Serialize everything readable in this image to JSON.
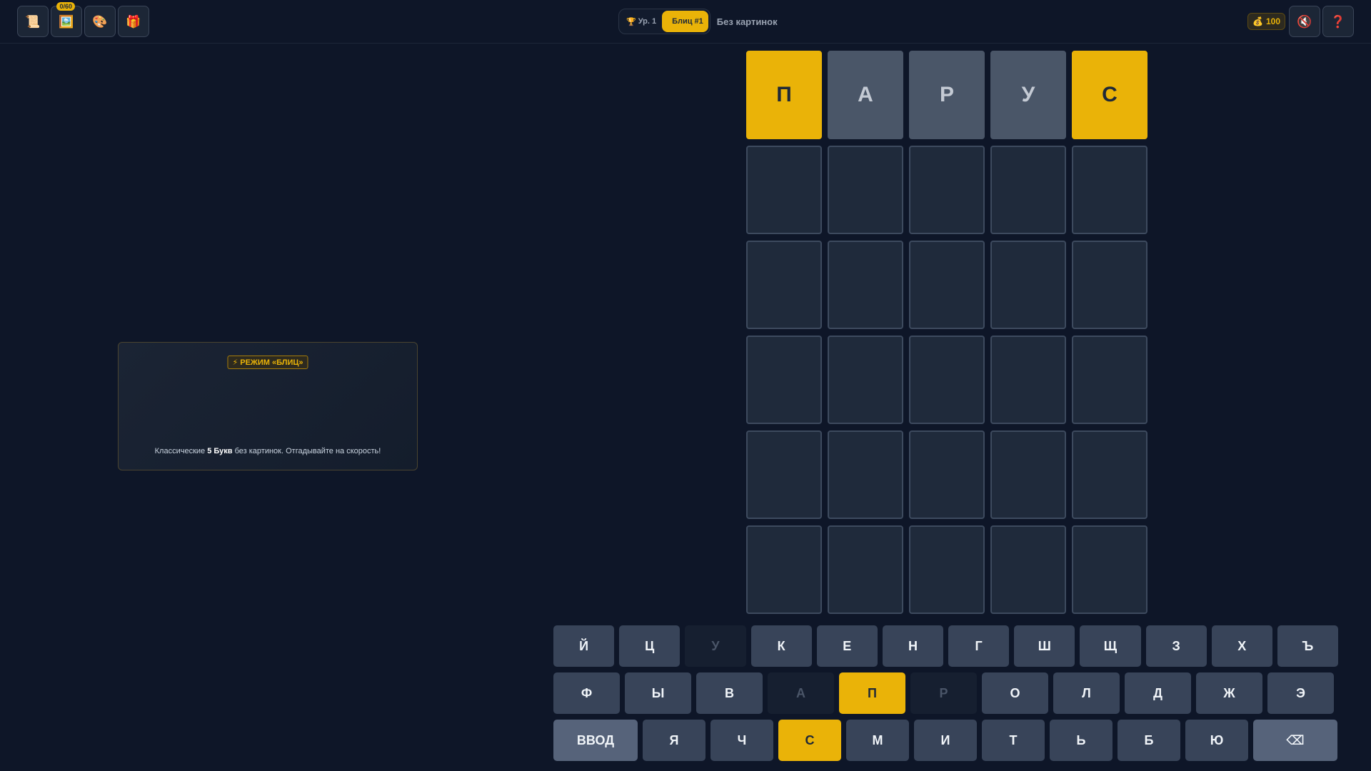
{
  "topbar": {
    "left_buttons": [
      {
        "icon": "📜",
        "icon_name": "scroll-icon"
      },
      {
        "icon": "🖼️",
        "icon_name": "picture-icon",
        "badge": "0/60"
      },
      {
        "icon": "🎨",
        "icon_name": "palette-icon"
      },
      {
        "icon": "🎁",
        "icon_name": "gift-icon"
      }
    ],
    "level_icon": "🏆",
    "level_label": "Ур. 1",
    "blitz_label": "Блиц #1",
    "subtitle": "Без картинок",
    "coins_icon": "💰",
    "coins": "100",
    "sound_icon": "🔇",
    "help_icon": "❓"
  },
  "info": {
    "tag": "⚡ РЕЖИМ «БЛИЦ»",
    "text_before": "Классические ",
    "text_bold": "5 Букв",
    "text_after": " без картинок. Отгадывайте на скорость!"
  },
  "board": {
    "rows": [
      [
        {
          "letter": "П",
          "state": "present"
        },
        {
          "letter": "А",
          "state": "absent"
        },
        {
          "letter": "Р",
          "state": "absent"
        },
        {
          "letter": "У",
          "state": "absent"
        },
        {
          "letter": "С",
          "state": "present"
        }
      ],
      [
        {
          "letter": "",
          "state": "empty"
        },
        {
          "letter": "",
          "state": "empty"
        },
        {
          "letter": "",
          "state": "empty"
        },
        {
          "letter": "",
          "state": "empty"
        },
        {
          "letter": "",
          "state": "empty"
        }
      ],
      [
        {
          "letter": "",
          "state": "empty"
        },
        {
          "letter": "",
          "state": "empty"
        },
        {
          "letter": "",
          "state": "empty"
        },
        {
          "letter": "",
          "state": "empty"
        },
        {
          "letter": "",
          "state": "empty"
        }
      ],
      [
        {
          "letter": "",
          "state": "empty"
        },
        {
          "letter": "",
          "state": "empty"
        },
        {
          "letter": "",
          "state": "empty"
        },
        {
          "letter": "",
          "state": "empty"
        },
        {
          "letter": "",
          "state": "empty"
        }
      ],
      [
        {
          "letter": "",
          "state": "empty"
        },
        {
          "letter": "",
          "state": "empty"
        },
        {
          "letter": "",
          "state": "empty"
        },
        {
          "letter": "",
          "state": "empty"
        },
        {
          "letter": "",
          "state": "empty"
        }
      ],
      [
        {
          "letter": "",
          "state": "empty"
        },
        {
          "letter": "",
          "state": "empty"
        },
        {
          "letter": "",
          "state": "empty"
        },
        {
          "letter": "",
          "state": "empty"
        },
        {
          "letter": "",
          "state": "empty"
        }
      ]
    ]
  },
  "keyboard": {
    "rows": [
      [
        {
          "label": "Й"
        },
        {
          "label": "Ц"
        },
        {
          "label": "У",
          "state": "absent"
        },
        {
          "label": "К"
        },
        {
          "label": "Е"
        },
        {
          "label": "Н"
        },
        {
          "label": "Г"
        },
        {
          "label": "Ш"
        },
        {
          "label": "Щ"
        },
        {
          "label": "З"
        },
        {
          "label": "Х"
        },
        {
          "label": "Ъ"
        }
      ],
      [
        {
          "label": "Ф"
        },
        {
          "label": "Ы"
        },
        {
          "label": "В"
        },
        {
          "label": "А",
          "state": "absent"
        },
        {
          "label": "П",
          "state": "present"
        },
        {
          "label": "Р",
          "state": "absent"
        },
        {
          "label": "О"
        },
        {
          "label": "Л"
        },
        {
          "label": "Д"
        },
        {
          "label": "Ж"
        },
        {
          "label": "Э"
        }
      ],
      [
        {
          "label": "ВВОД",
          "wide": true,
          "name": "enter-key"
        },
        {
          "label": "Я"
        },
        {
          "label": "Ч"
        },
        {
          "label": "С",
          "state": "present"
        },
        {
          "label": "М"
        },
        {
          "label": "И"
        },
        {
          "label": "Т"
        },
        {
          "label": "Ь"
        },
        {
          "label": "Б"
        },
        {
          "label": "Ю"
        },
        {
          "label": "⌫",
          "wide": true,
          "name": "backspace-key"
        }
      ]
    ]
  },
  "colors": {
    "background": "#0e1628",
    "accent": "#eab308",
    "absent_tile": "#4a5668",
    "empty_tile": "#1f2a3b"
  }
}
